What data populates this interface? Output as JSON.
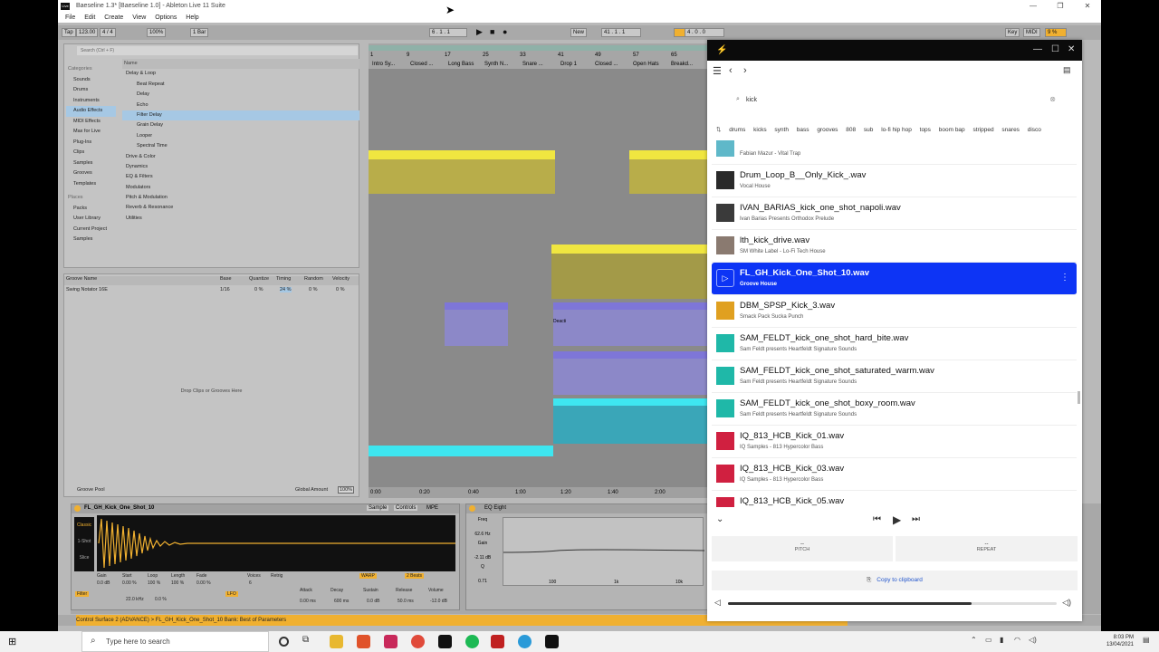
{
  "ableton": {
    "window_title": "Baeseline 1.3* [Baeseline 1.0] - Ableton Live 11 Suite",
    "menu": [
      "File",
      "Edit",
      "Create",
      "View",
      "Options",
      "Help"
    ],
    "tempo": "123.00",
    "time_sig": "4 / 4",
    "zoom": "100%",
    "quantize": "1 Bar",
    "position": "6 . 1 . 1",
    "new_label": "New",
    "loop_start": "41 . 1 . 1",
    "loop_len": "4 . 0 . 0",
    "key_label": "Key",
    "midi_label": "MIDI",
    "cpu": "9 %",
    "tap_label": "Tap",
    "browser_search": "Search (Ctrl + F)",
    "categories_header": "Categories",
    "categories": [
      "Sounds",
      "Drums",
      "Instruments",
      "Audio Effects",
      "MIDI Effects",
      "Max for Live",
      "Plug-Ins",
      "Clips",
      "Samples",
      "Grooves",
      "Templates"
    ],
    "places_header": "Places",
    "places": [
      "Packs",
      "User Library",
      "Current Project",
      "Samples"
    ],
    "name_header": "Name",
    "tree": [
      "Delay & Loop",
      "Beat Repeat",
      "Delay",
      "Echo",
      "Filter Delay",
      "Grain Delay",
      "Looper",
      "Spectral Time",
      "Drive & Color",
      "Dynamics",
      "EQ & Filters",
      "Modulators",
      "Pitch & Modulation",
      "Reverb & Resonance",
      "Utilities"
    ],
    "groove_headers": [
      "Groove Name",
      "Base",
      "Quantize",
      "Timing",
      "Random",
      "Velocity"
    ],
    "groove_row": [
      "Swing Notator 16E",
      "1/16",
      "0 %",
      "24 %",
      "0 %",
      "0 %"
    ],
    "groove_drop": "Drop Clips or Grooves Here",
    "groove_pool": "Groove Pool",
    "global_amount_label": "Global Amount",
    "global_amount": "100%",
    "ruler_bars": [
      "1",
      "9",
      "17",
      "25",
      "33",
      "41",
      "49",
      "57",
      "65"
    ],
    "ruler_times": [
      "0:00",
      "0:20",
      "0:40",
      "1:00",
      "1:20",
      "1:40",
      "2:00"
    ],
    "locators": [
      "Intro Sy...",
      "Closed ...",
      "Long Bass",
      "Synth N...",
      "Snare ...",
      "Drop 1",
      "Closed ...",
      "Open Hats",
      "Breakd..."
    ],
    "deactivated": "Deacti",
    "clip_name": "FL_GH_Kick_One_Shot_10",
    "sample_tabs": [
      "Sample",
      "Controls",
      "MPE"
    ],
    "sample_mode": "Classic",
    "sample_one_shot": "1-Shot",
    "sample_slice": "Slice",
    "warp_label": "WARP",
    "beats_label": "2 Beats",
    "filter_label": "Filter",
    "lfo_label": "LFO",
    "envelope_labels": [
      "Attack",
      "Decay",
      "Sustain",
      "Release",
      "Volume"
    ],
    "envelope_values": [
      "0.00 ms",
      "600 ms",
      "0.0 dB",
      "50.0 ms",
      "-12.0 dB"
    ],
    "gain_labels": [
      "Gain",
      "Start",
      "Loop",
      "Length",
      "Fade",
      "Voices",
      "Retrig"
    ],
    "gain_values": [
      "0.0 dB",
      "0.00 %",
      "100 %",
      "100 %",
      "0.00 %",
      "6"
    ],
    "freq_value": "22.0 kHz",
    "res_value": "0.0 %",
    "eq_title": "EQ Eight",
    "eq_freq": "62.6 Hz",
    "eq_gain": "-2.11 dB",
    "eq_q": "0.71",
    "eq_labels": [
      "Freq",
      "Gain",
      "Q"
    ],
    "eq_axis": [
      "100",
      "1k",
      "10k"
    ],
    "status_msg": "Control Surface 2 (ADVANCE) > FL_GH_Kick_One_Shot_10 Bank: Best of Parameters"
  },
  "splice": {
    "search_query": "kick",
    "tags": [
      "drums",
      "kicks",
      "synth",
      "bass",
      "grooves",
      "808",
      "sub",
      "lo-fi hip hop",
      "tops",
      "boom bap",
      "stripped",
      "snares",
      "disco"
    ],
    "results": [
      {
        "name": "",
        "sub": "Fabian Mazur - Vital Trap",
        "thumb": "#5fb8c9"
      },
      {
        "name": "Drum_Loop_B__Only_Kick_.wav",
        "sub": "Vocal House",
        "thumb": "#2a2a2a"
      },
      {
        "name": "IVAN_BARIAS_kick_one_shot_napoli.wav",
        "sub": "Ivan Barias Presents Orthodox Prelude",
        "thumb": "#3a3a3a"
      },
      {
        "name": "lth_kick_drive.wav",
        "sub": "SM White Label - Lo-Fi Tech House",
        "thumb": "#8a7a70"
      },
      {
        "name": "FL_GH_Kick_One_Shot_10.wav",
        "sub": "Groove House",
        "thumb": "#0d34f5",
        "active": true
      },
      {
        "name": "DBM_SPSP_Kick_3.wav",
        "sub": "Smack Pack Sucka Punch",
        "thumb": "#e0a020"
      },
      {
        "name": "SAM_FELDT_kick_one_shot_hard_bite.wav",
        "sub": "Sam Feldt presents Heartfeldt Signature Sounds",
        "thumb": "#1fb8a8"
      },
      {
        "name": "SAM_FELDT_kick_one_shot_saturated_warm.wav",
        "sub": "Sam Feldt presents Heartfeldt Signature Sounds",
        "thumb": "#1fb8a8"
      },
      {
        "name": "SAM_FELDT_kick_one_shot_boxy_room.wav",
        "sub": "Sam Feldt presents Heartfeldt Signature Sounds",
        "thumb": "#1fb8a8"
      },
      {
        "name": "IQ_813_HCB_Kick_01.wav",
        "sub": "IQ Samples - 813 Hypercolor Bass",
        "thumb": "#d02040"
      },
      {
        "name": "IQ_813_HCB_Kick_03.wav",
        "sub": "IQ Samples - 813 Hypercolor Bass",
        "thumb": "#d02040"
      },
      {
        "name": "IQ_813_HCB_Kick_05.wav",
        "sub": "IQ Samples - 813 Hypercolor Bass",
        "thumb": "#d02040"
      }
    ],
    "pitch_label": "PITCH",
    "pitch_value": "--",
    "repeat_label": "REPEAT",
    "repeat_value": "--",
    "copy_label": "Copy to clipboard",
    "volume": 0.74
  },
  "taskbar": {
    "search_placeholder": "Type here to search",
    "time": "8:03 PM",
    "date": "13/04/2021"
  }
}
